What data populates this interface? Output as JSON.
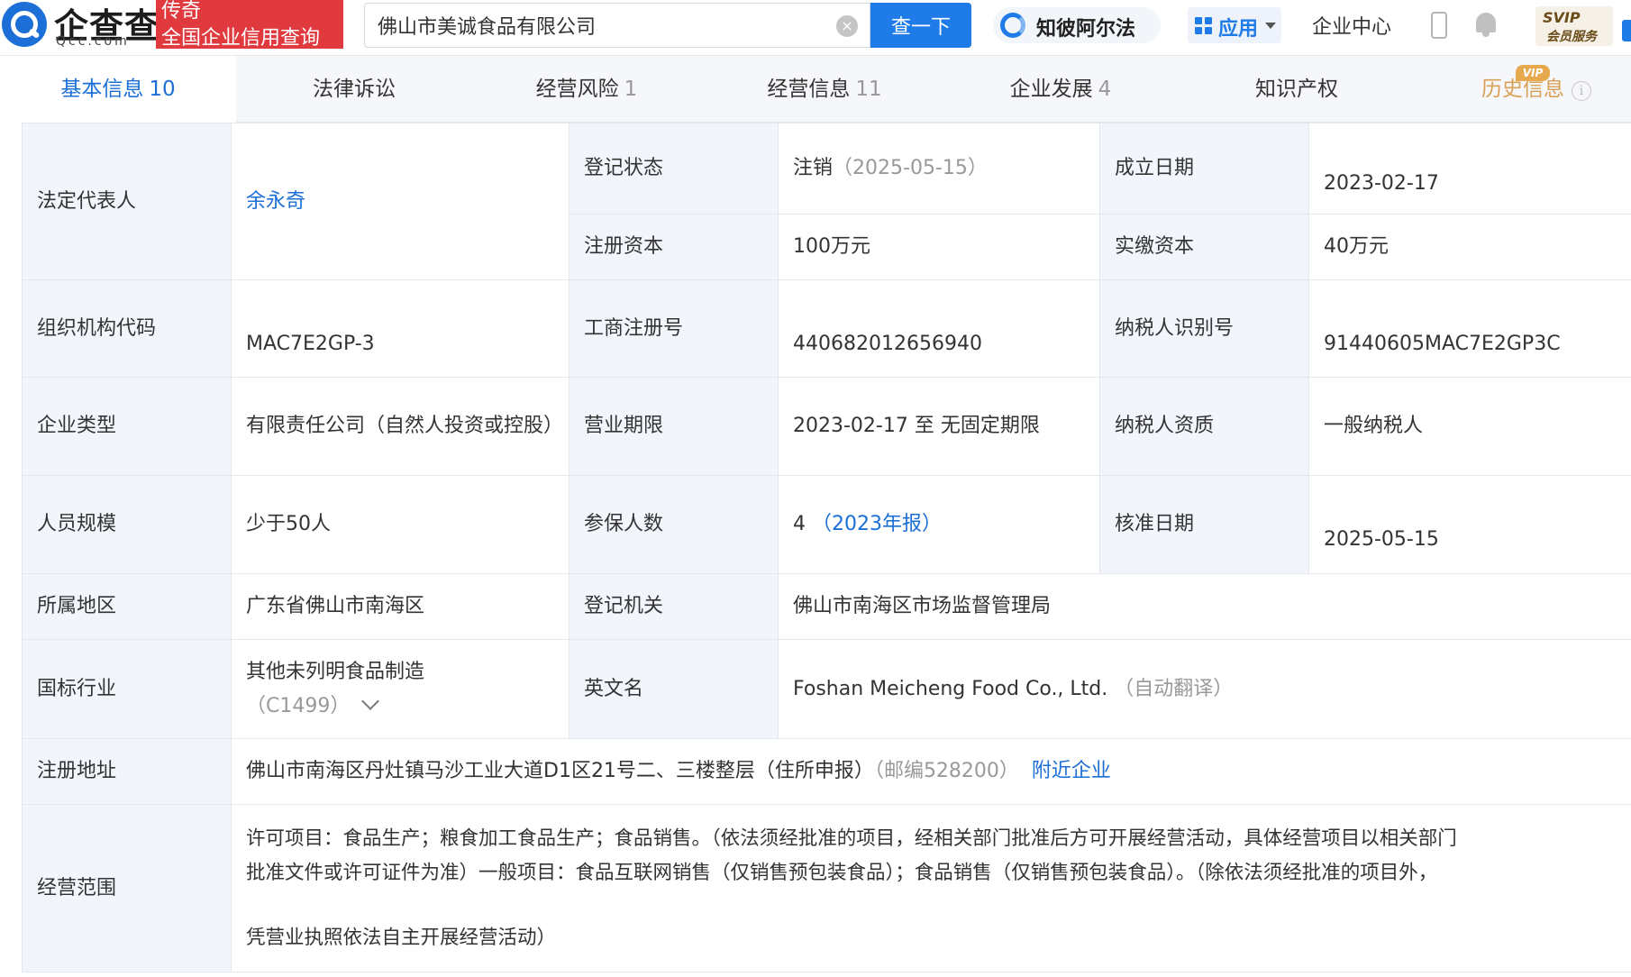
{
  "header": {
    "logo_text": "企查查",
    "logo_domain": "Qcc.com",
    "promo_line1": "传奇",
    "promo_line2": "全国企业信用查询",
    "search_value": "佛山市美诚食品有限公司",
    "search_button": "查一下",
    "zhibi_label": "知彼阿尔法",
    "apps_label": "应用",
    "enterprise_center": "企业中心",
    "svip_line1": "SVIP",
    "svip_line2": "会员服务"
  },
  "tabs": [
    {
      "label": "基本信息",
      "count": "10"
    },
    {
      "label": "法律诉讼",
      "count": ""
    },
    {
      "label": "经营风险",
      "count": "1"
    },
    {
      "label": "经营信息",
      "count": "11"
    },
    {
      "label": "企业发展",
      "count": "4"
    },
    {
      "label": "知识产权",
      "count": ""
    },
    {
      "label": "历史信息",
      "count": "",
      "badge": "VIP"
    }
  ],
  "info": {
    "legal_rep_label": "法定代表人",
    "legal_rep_value": "余永奇",
    "reg_status_label": "登记状态",
    "reg_status_value": "注销",
    "reg_status_date": "（2025-05-15）",
    "found_date_label": "成立日期",
    "found_date_value": "2023-02-17",
    "reg_capital_label": "注册资本",
    "reg_capital_value": "100万元",
    "paid_capital_label": "实缴资本",
    "paid_capital_value": "40万元",
    "org_code_label": "组织机构代码",
    "org_code_value": "MAC7E2GP-3",
    "biz_reg_no_label": "工商注册号",
    "biz_reg_no_value": "440682012656940",
    "taxpayer_id_label": "纳税人识别号",
    "taxpayer_id_value": "91440605MAC7E2GP3C",
    "company_type_label": "企业类型",
    "company_type_value": "有限责任公司（自然人投资或控股）",
    "biz_term_label": "营业期限",
    "biz_term_value": "2023-02-17 至 无固定期限",
    "taxpayer_qual_label": "纳税人资质",
    "taxpayer_qual_value": "一般纳税人",
    "staff_size_label": "人员规模",
    "staff_size_value": "少于50人",
    "insured_label": "参保人数",
    "insured_value": "4",
    "insured_report": "（2023年报）",
    "approve_date_label": "核准日期",
    "approve_date_value": "2025-05-15",
    "region_label": "所属地区",
    "region_value": "广东省佛山市南海区",
    "reg_authority_label": "登记机关",
    "reg_authority_value": "佛山市南海区市场监督管理局",
    "industry_label": "国标行业",
    "industry_value": "其他未列明食品制造",
    "industry_code": "（C1499）",
    "english_name_label": "英文名",
    "english_name_value": "Foshan Meicheng Food Co., Ltd.",
    "english_name_note": "（自动翻译）",
    "address_label": "注册地址",
    "address_value": "佛山市南海区丹灶镇马沙工业大道D1区21号二、三楼整层（住所申报）",
    "address_zip": "（邮编528200）",
    "address_nearby": "附近企业",
    "scope_label": "经营范围",
    "scope_line1": "许可项目：食品生产；粮食加工食品生产；食品销售。（依法须经批准的项目，经相关部门批准后方可开展经营活动，具体经营项目以相关部门",
    "scope_line2": "批准文件或许可证件为准）一般项目：食品互联网销售（仅销售预包装食品）；食品销售（仅销售预包装食品）。（除依法须经批准的项目外，",
    "scope_line3": "凭营业执照依法自主开展经营活动）"
  },
  "colors": {
    "accent": "#1e7be8",
    "link": "#1c6fd6",
    "promo_red": "#e0393e",
    "label_bg": "#f2f6fc",
    "vip_gold": "#d9a056"
  }
}
